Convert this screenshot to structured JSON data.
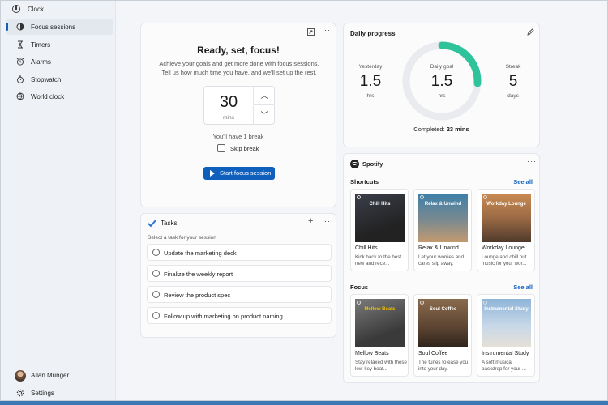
{
  "window": {
    "title": "Clock",
    "controls": [
      "—",
      "☐",
      "✕"
    ]
  },
  "sidebar": {
    "items": [
      {
        "label": "Focus sessions",
        "icon": "focus-icon",
        "active": true
      },
      {
        "label": "Timers",
        "icon": "hourglass-icon"
      },
      {
        "label": "Alarms",
        "icon": "alarm-icon"
      },
      {
        "label": "Stopwatch",
        "icon": "stopwatch-icon"
      },
      {
        "label": "World clock",
        "icon": "globe-icon"
      }
    ],
    "user": "Allan Munger",
    "settings": "Settings"
  },
  "focus": {
    "title": "Ready, set, focus!",
    "description": "Achieve your goals and get more done with focus sessions. Tell us how much time you have, and we'll set up the rest.",
    "minutes": "30",
    "unit": "mins",
    "break_text": "You'll have 1 break",
    "skip_label": "Skip break",
    "start_label": "Start focus session"
  },
  "tasks": {
    "title": "Tasks",
    "subtitle": "Select a task for your session",
    "items": [
      "Update the marketing deck",
      "Finalize the weekly report",
      "Review the product spec",
      "Follow up with marketing on product naming"
    ]
  },
  "progress": {
    "title": "Daily progress",
    "yesterday": {
      "label": "Yesterday",
      "value": "1.5",
      "unit": "hrs"
    },
    "goal": {
      "label": "Daily goal",
      "value": "1.5",
      "unit": "hrs"
    },
    "streak": {
      "label": "Streak",
      "value": "5",
      "unit": "days"
    },
    "completed_prefix": "Completed:",
    "completed_value": "23 mins",
    "ring_fraction": 0.26,
    "colors": {
      "ring": "#2ec39a",
      "track": "#e9ebee"
    }
  },
  "spotify": {
    "name": "Spotify",
    "shortcuts_title": "Shortcuts",
    "focus_title": "Focus",
    "see_all": "See all",
    "shortcuts": [
      {
        "art": "Chill Hits",
        "title": "Chill Hits",
        "desc": "Kick back to the best new and rece..."
      },
      {
        "art": "Relax & Unwind",
        "title": "Relax & Unwind",
        "desc": "Let your worries and cares slip away."
      },
      {
        "art": "Workday Lounge",
        "title": "Workday Lounge",
        "desc": "Lounge and chill out music for your wor..."
      }
    ],
    "focus": [
      {
        "art": "Mellow Beats",
        "title": "Mellow Beats",
        "desc": "Stay relaxed with these low-key beat..."
      },
      {
        "art": "Soul Coffee",
        "title": "Soul Coffee",
        "desc": "The tunes to ease you into your day."
      },
      {
        "art": "Instrumental Study",
        "title": "Instrumental Study",
        "desc": "A soft musical backdrop for your ..."
      }
    ]
  }
}
